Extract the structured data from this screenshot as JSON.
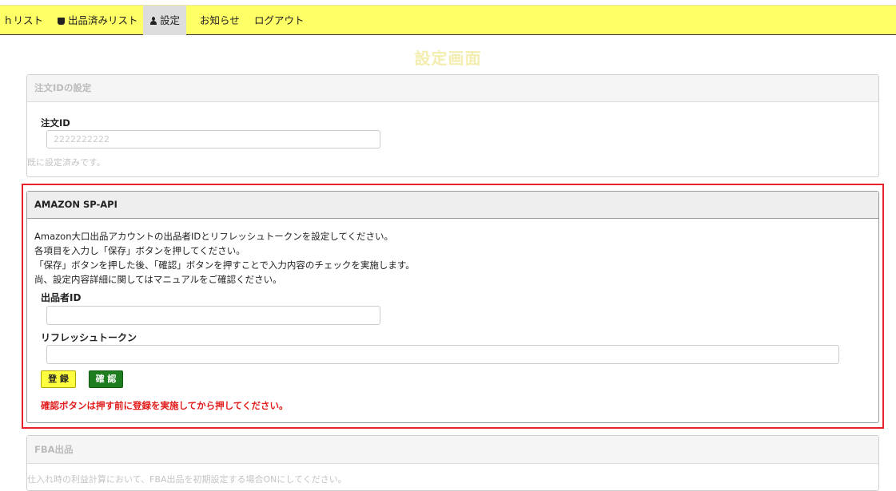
{
  "nav": {
    "items": [
      {
        "label": "ｈリスト"
      },
      {
        "label": "出品済みリスト",
        "icon": "cart-icon"
      },
      {
        "label": "設定",
        "icon": "user-icon",
        "active": true
      },
      {
        "label": "お知らせ"
      },
      {
        "label": "ログアウト"
      }
    ],
    "colors": {
      "background": "#ffff66",
      "active": "#dddddd"
    }
  },
  "page_title": "設定画面",
  "order_panel": {
    "heading": "注文IDの設定",
    "field_label": "注文ID",
    "field_value": "2222222222",
    "status_text": "既に設定済みです。"
  },
  "spapi_panel": {
    "heading": "AMAZON SP-API",
    "description": [
      "Amazon大口出品アカウントの出品者IDとリフレッシュトークンを設定してください。",
      "各項目を入力し「保存」ボタンを押してください。",
      "「保存」ボタンを押した後、「確認」ボタンを押すことで入力内容のチェックを実施します。",
      "尚、設定内容詳細に関してはマニュアルをご確認ください。"
    ],
    "seller_id_label": "出品者ID",
    "seller_id_value": "",
    "refresh_token_label": "リフレッシュトークン",
    "refresh_token_value": "",
    "register_button": "登 録",
    "confirm_button": "確 認",
    "warning": "確認ボタンは押す前に登録を実施してから押してください。",
    "highlight_color": "#e8202a"
  },
  "fba_panel": {
    "heading": "FBA出品",
    "description": "仕入れ時の利益計算において、FBA出品を初期設定する場合ONにしてください。"
  }
}
